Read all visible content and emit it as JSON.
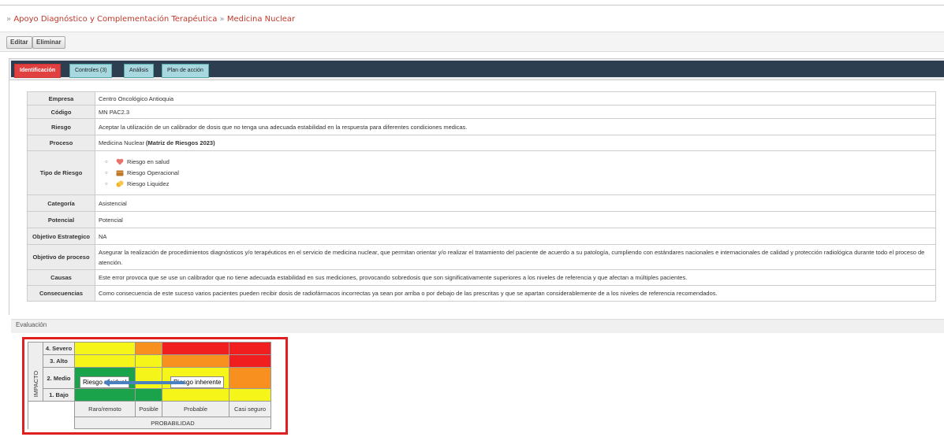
{
  "breadcrumb": {
    "prefix": "»",
    "section": "Apoyo Diagnóstico y Complementación Terapéutica",
    "separator": "»",
    "page": "Medicina Nuclear"
  },
  "toolbar": {
    "edit_label": "Editar",
    "delete_label": "Eliminar"
  },
  "tabs": [
    {
      "label": "Identificación",
      "active": true
    },
    {
      "label": "Controles (3)",
      "active": false
    },
    {
      "label": "Análisis",
      "active": false
    },
    {
      "label": "Plan de acción",
      "active": false
    }
  ],
  "info": {
    "empresa": {
      "label": "Empresa",
      "value": "Centro Oncológico Antioquia"
    },
    "codigo": {
      "label": "Código",
      "value": "MN PAC2.3"
    },
    "riesgo": {
      "label": "Riesgo",
      "value": "Aceptar la utilización de un calibrador de dosis que no tenga una adecuada estabilidad en la respuesta para diferentes condiciones medicas."
    },
    "proceso": {
      "label": "Proceso",
      "value": "Medicina Nuclear",
      "bold_suffix": "(Matriz de Riesgos 2023)"
    },
    "tipo_riesgo": {
      "label": "Tipo de Riesgo",
      "items": [
        {
          "label": "Riesgo en salud",
          "icon": "heart-icon"
        },
        {
          "label": "Riesgo Operacional",
          "icon": "folder-icon"
        },
        {
          "label": "Riesgo Liquidez",
          "icon": "coins-icon"
        }
      ]
    },
    "categoria": {
      "label": "Categoría",
      "value": "Asistencial"
    },
    "potencial": {
      "label": "Potencial",
      "value": "Potencial"
    },
    "objetivo_estrategico": {
      "label": "Objetivo Estrategico",
      "value": "NA"
    },
    "objetivo_proceso": {
      "label": "Objetivo de proceso",
      "value": "Asegurar la realización de procedimientos diagnósticos y/o terapéuticos en el servicio de medicina nuclear, que permitan orientar y/o realizar el tratamiento del paciente de acuerdo a su patología, cumpliendo con estándares nacionales e internacionales de calidad y protección radiológica durante todo el proceso de atención."
    },
    "causas": {
      "label": "Causas",
      "value": "Este error provoca que se use un calibrador que no tiene adecuada estabilidad en sus mediciones, provocando sobredosis que son significativamente superiores a los niveles de referencia y que afectan a múltiples pacientes."
    },
    "consecuencias": {
      "label": "Consecuencias",
      "value": "Como consecuencia de este suceso varios pacientes pueden recibir dosis de radiofármacos incorrectas ya sean por arriba o por debajo de las prescritas y que se apartan considerablemente de a los niveles de referencia recomendados."
    }
  },
  "evaluacion": {
    "title": "Evaluación",
    "matrix": {
      "y_axis_label": "IMPACTO",
      "x_axis_label": "PROBABILIDAD",
      "rows": [
        "4. Severo",
        "3. Alto",
        "2. Medio",
        "1. Bajo"
      ],
      "columns": [
        "Raro/remoto",
        "Posible",
        "Probable",
        "Casi seguro"
      ],
      "residual_label": "Riesgo residual",
      "inherent_label": "Riesgo inherente",
      "colors": {
        "yellow": "#f5f51a",
        "orange": "#f7901e",
        "red": "#f01e1e",
        "green": "#1aa34a",
        "arrow": "#4a7fc0",
        "highlight": "#e02020"
      }
    }
  }
}
